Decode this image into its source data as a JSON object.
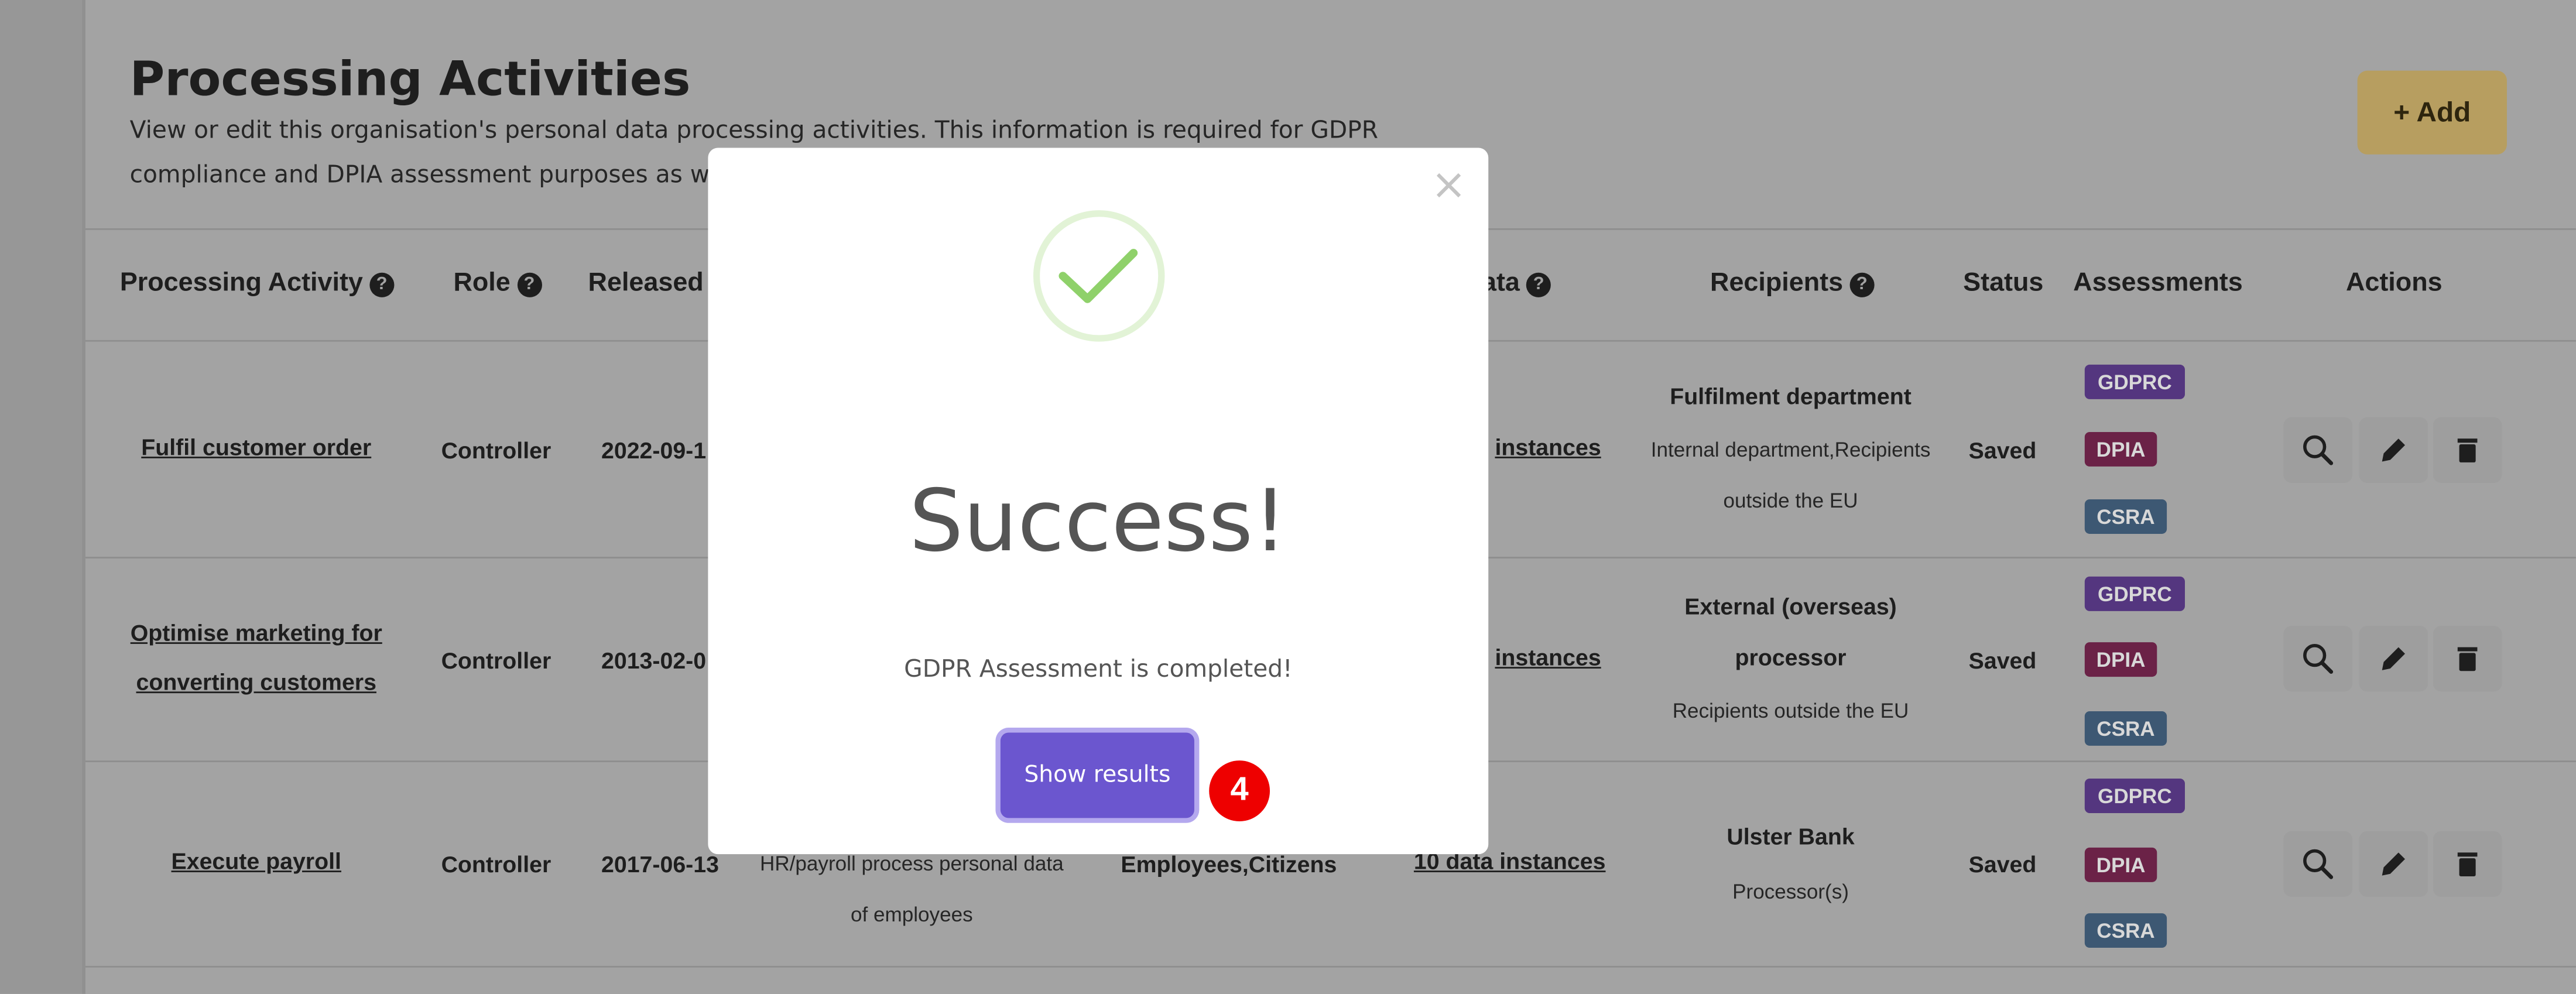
{
  "page": {
    "title": "Processing Activities",
    "description": "View or edit this organisation's personal data processing activities. This information is required for GDPR compliance and DPIA assessment purposes as we",
    "add_label": "+ Add"
  },
  "headers": {
    "activity": "Processing Activity",
    "role": "Role",
    "released": "Released",
    "data": "ata",
    "recipients": "Recipients",
    "status": "Status",
    "assessments": "Assessments",
    "actions": "Actions"
  },
  "rows": [
    {
      "activity_line1": "Fulfil customer order",
      "activity_line2": "",
      "role": "Controller",
      "released": "2022-09-1",
      "purpose_line1": "",
      "purpose_line2": "",
      "subjects": "",
      "data": "instances",
      "recipient_name_line1": "Fulfilment department",
      "recipient_name_line2": "",
      "recipient_type_line1": "Internal department,Recipients",
      "recipient_type_line2": "outside the EU",
      "status": "Saved"
    },
    {
      "activity_line1": "Optimise marketing for",
      "activity_line2": "converting customers",
      "role": "Controller",
      "released": "2013-02-0",
      "purpose_line1": "",
      "purpose_line2": "",
      "subjects": "",
      "data": "instances",
      "recipient_name_line1": "External (overseas)",
      "recipient_name_line2": "processor",
      "recipient_type_line1": "Recipients outside the EU",
      "recipient_type_line2": "",
      "status": "Saved"
    },
    {
      "activity_line1": "Execute payroll",
      "activity_line2": "",
      "role": "Controller",
      "released": "2017-06-13",
      "purpose_line1": "HR/payroll process personal data",
      "purpose_line2": "of employees",
      "subjects": "Employees,Citizens",
      "data": "10 data instances",
      "recipient_name_line1": "Ulster Bank",
      "recipient_name_line2": "",
      "recipient_type_line1": "Processor(s)",
      "recipient_type_line2": "",
      "status": "Saved"
    }
  ],
  "badges": {
    "gdprc": "GDPRC",
    "dpia": "DPIA",
    "csra": "CSRA"
  },
  "icons": {
    "help": "?",
    "view": "search-icon",
    "edit": "pencil-icon",
    "delete": "trash-icon"
  },
  "modal": {
    "close": "×",
    "title": "Success!",
    "message": "GDPR Assessment is completed!",
    "button": "Show results"
  },
  "step_badge": "4",
  "colors": {
    "primary": "#6a55d1",
    "success": "#8fd16a",
    "add_button": "#e2c06f",
    "step": "#ee0000"
  }
}
